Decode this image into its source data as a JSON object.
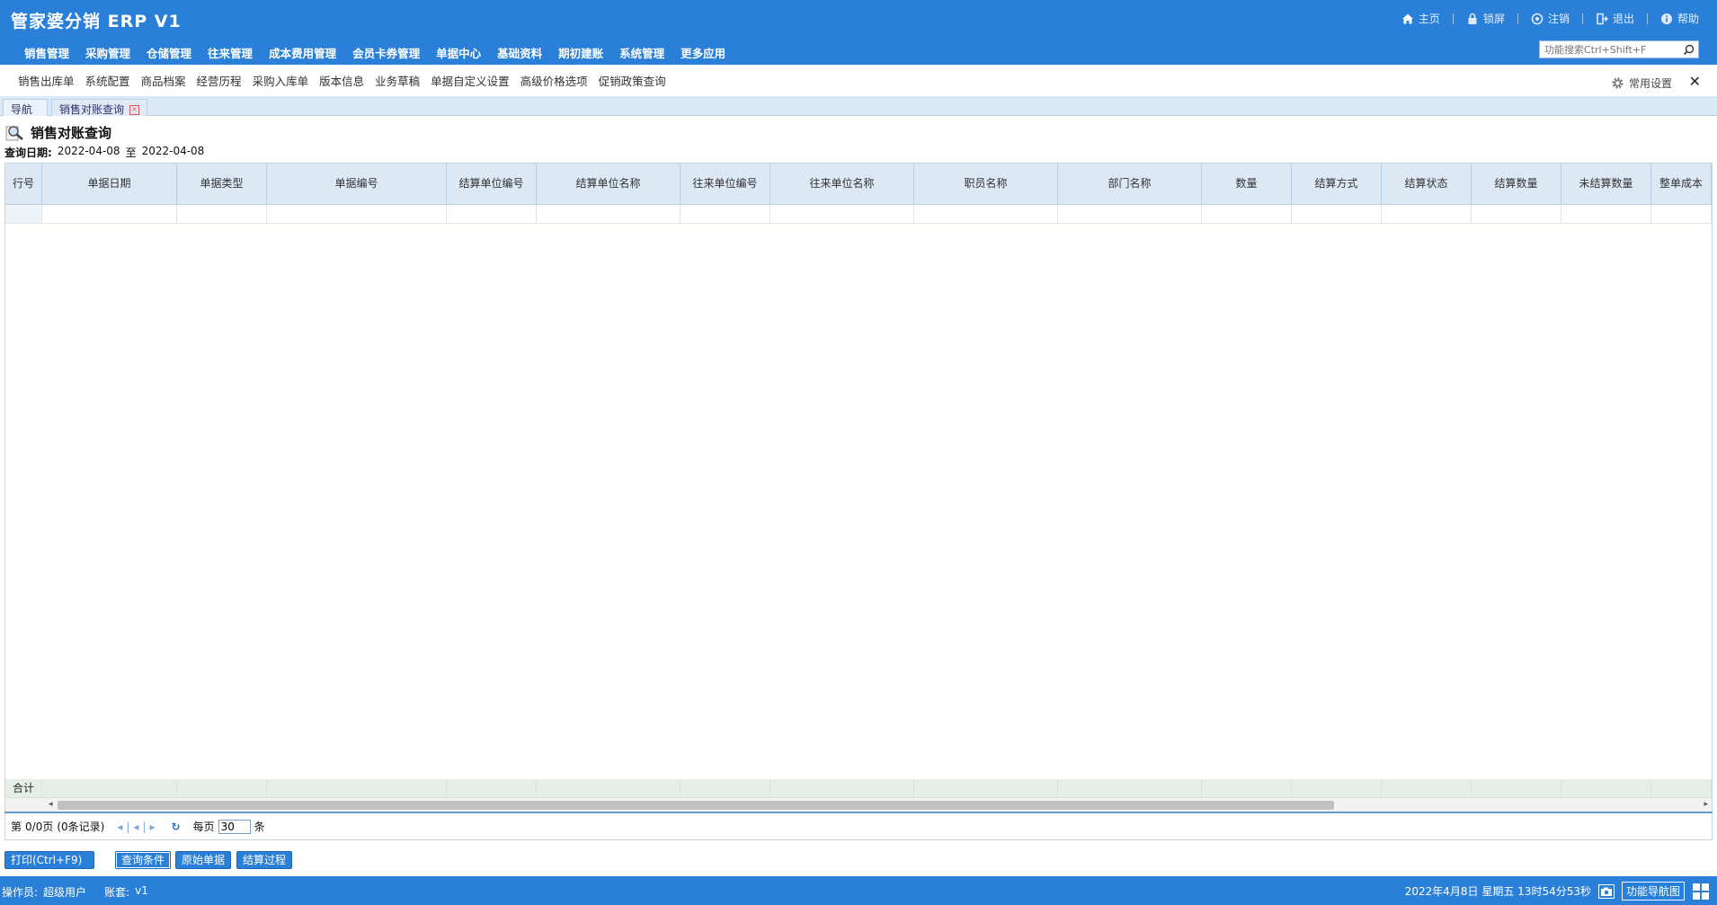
{
  "app": {
    "title": "管家婆分销 ERP V1"
  },
  "top_links": [
    {
      "label": "主页",
      "icon": "home-icon"
    },
    {
      "label": "锁屏",
      "icon": "lock-icon"
    },
    {
      "label": "注销",
      "icon": "logout-circle-icon"
    },
    {
      "label": "退出",
      "icon": "exit-icon"
    },
    {
      "label": "帮助",
      "icon": "help-icon"
    }
  ],
  "nav": [
    "销售管理",
    "采购管理",
    "仓储管理",
    "往来管理",
    "成本费用管理",
    "会员卡券管理",
    "单据中心",
    "基础资料",
    "期初建账",
    "系统管理",
    "更多应用"
  ],
  "search": {
    "placeholder": "功能搜索Ctrl+Shift+F"
  },
  "quick_links": [
    "销售出库单",
    "系统配置",
    "商品档案",
    "经营历程",
    "采购入库单",
    "版本信息",
    "业务草稿",
    "单据自定义设置",
    "高级价格选项",
    "促销政策查询"
  ],
  "settings": {
    "label": "常用设置"
  },
  "tabs": [
    {
      "label": "导航"
    },
    {
      "label": "销售对账查询"
    }
  ],
  "page": {
    "title": "销售对账查询",
    "date_label": "查询日期:",
    "date_from": "2022-04-08",
    "date_sep": "至",
    "date_to": "2022-04-08"
  },
  "table": {
    "columns": [
      "行号",
      "单据日期",
      "单据类型",
      "单据编号",
      "结算单位编号",
      "结算单位名称",
      "往来单位编号",
      "往来单位名称",
      "职员名称",
      "部门名称",
      "数量",
      "结算方式",
      "结算状态",
      "结算数量",
      "未结算数量",
      "整单成本"
    ],
    "total_label": "合计"
  },
  "pager": {
    "page_prefix": "第",
    "page_info": "0/0页",
    "records": "(0条记录)",
    "per_page_label": "每页",
    "per_page_value": "30",
    "per_page_suffix": "条"
  },
  "buttons": {
    "print": "打印(Ctrl+F9)",
    "query": "查询条件",
    "original": "原始单据",
    "process": "结算过程"
  },
  "status": {
    "operator_label": "操作员:",
    "operator": "超级用户",
    "account_label": "账套:",
    "account": "v1",
    "datetime": "2022年4月8日  星期五  13时54分53秒",
    "nav_btn": "功能导航图"
  }
}
